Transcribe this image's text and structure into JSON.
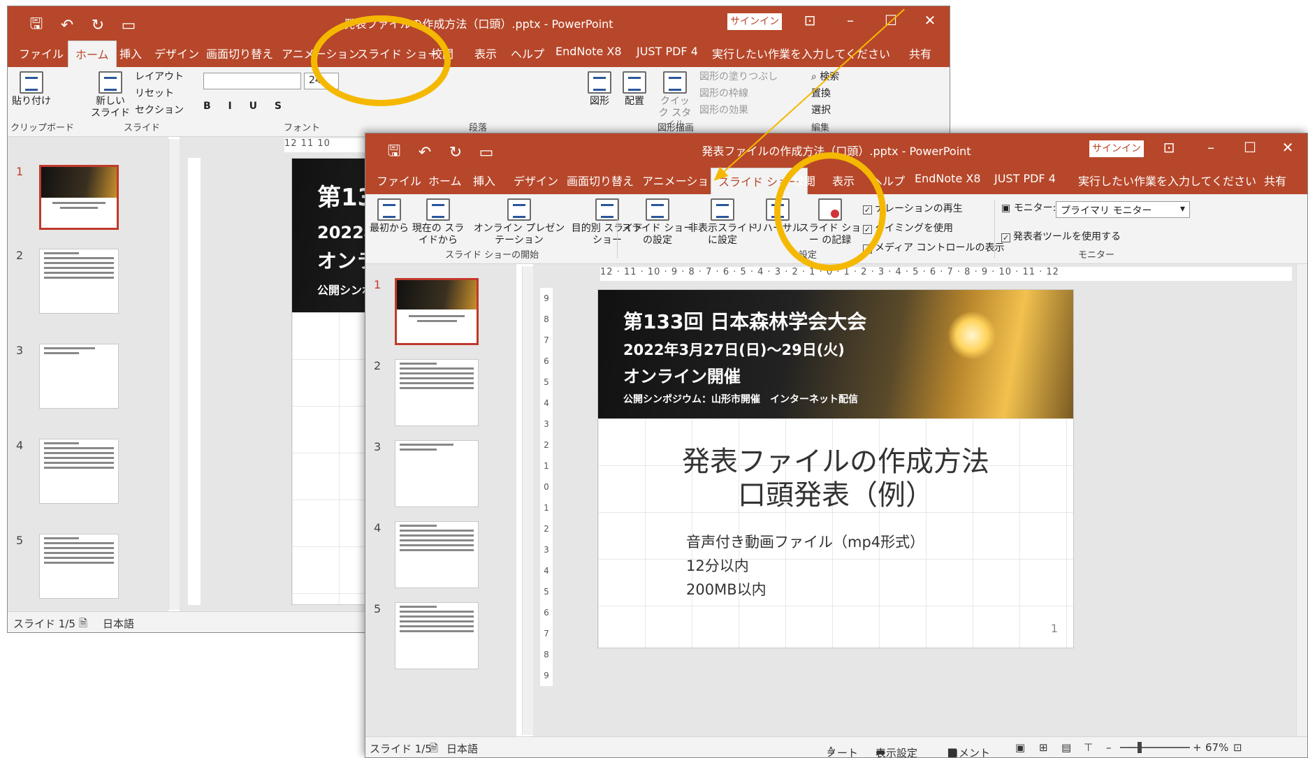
{
  "window_back": {
    "title": "発表ファイルの作成方法（口頭）.pptx - PowerPoint",
    "signin": "サインイン",
    "tabs": [
      "ファイル",
      "ホーム",
      "挿入",
      "デザイン",
      "画面切り替え",
      "アニメーション",
      "スライド ショー",
      "校閲",
      "表示",
      "ヘルプ",
      "EndNote X8",
      "JUST PDF 4",
      "実行したい作業を入力してください",
      "共有"
    ],
    "selected_tab": "ホーム",
    "ribbon": {
      "paste": "貼り付け",
      "new_slide": "新しい\nスライド",
      "layout": "レイアウト",
      "reset": "リセット",
      "section": "セクション",
      "font_size": "24",
      "shape": "図形",
      "arrange": "配置",
      "quick_style": "クイック\nスタイル",
      "shape_fill": "図形の塗りつぶし",
      "shape_outline": "図形の枠線",
      "shape_effects": "図形の効果",
      "find": "検索",
      "replace": "置換",
      "select": "選択",
      "groups": [
        "クリップボード",
        "スライド",
        "フォント",
        "段落",
        "図形描画",
        "編集"
      ]
    },
    "ruler_h": "12 11 10",
    "slide_text": {
      "b1": "第13",
      "b2": "2022年",
      "b3": "オンラ",
      "b4": "公開シンポ"
    },
    "status": {
      "slide": "スライド 1/5",
      "lang": "日本語"
    }
  },
  "window_front": {
    "title": "発表ファイルの作成方法（口頭）.pptx - PowerPoint",
    "signin": "サインイン",
    "tabs": [
      "ファイル",
      "ホーム",
      "挿入",
      "デザイン",
      "画面切り替え",
      "アニメーション",
      "スライド ショー",
      "校閲",
      "表示",
      "ヘルプ",
      "EndNote X8",
      "JUST PDF 4",
      "実行したい作業を入力してください",
      "共有"
    ],
    "selected_tab": "スライド ショー",
    "ribbon": {
      "from_start": "最初から",
      "from_current": "現在の\nスライドから",
      "online": "オンライン\nプレゼンテーション",
      "custom": "目的別\nスライド ショー",
      "setup": "スライド ショー\nの設定",
      "hide": "非表示スライド\nに設定",
      "rehearse": "リハーサル",
      "record": "スライド ショー\nの記録",
      "play_narration": "ナレーションの再生",
      "use_timings": "タイミングを使用",
      "show_media": "メディア コントロールの表示",
      "monitor_label": "モニター:",
      "monitor_value": "プライマリ モニター",
      "presenter_view": "発表者ツールを使用する",
      "group_start": "スライド ショーの開始",
      "group_setup": "設定",
      "group_monitor": "モニター"
    },
    "ruler_h": "12 · 11 · 10 · 9 · 8 · 7 · 6 · 5 · 4 · 3 · 2 · 1 · 0 · 1 · 2 · 3 · 4 · 5 · 6 · 7 · 8 · 9 · 10 · 11 · 12",
    "ruler_v": [
      "9",
      "8",
      "7",
      "6",
      "5",
      "4",
      "3",
      "2",
      "1",
      "0",
      "1",
      "2",
      "3",
      "4",
      "5",
      "6",
      "7",
      "8",
      "9"
    ],
    "slide": {
      "banner_title": "第133回 日本森林学会大会",
      "banner_date": "2022年3月27日(日)～29日(火)",
      "banner_mode": "オンライン開催",
      "banner_sub": "公開シンポジウム：山形市開催　インターネット配信",
      "title_line1": "発表ファイルの作成方法",
      "title_line2": "口頭発表（例）",
      "body": [
        "音声付き動画ファイル（mp4形式）",
        "12分以内",
        "200MB以内"
      ],
      "page_number": "1"
    },
    "status": {
      "slide": "スライド 1/5",
      "lang": "日本語",
      "notes": "ノート",
      "display": "表示設定",
      "comments": "コメント",
      "zoom": "67%"
    }
  },
  "thumbnails": [
    {
      "num": "1",
      "title": "発表ファイルの作成方法\n口頭発表（例）",
      "selected": true
    },
    {
      "num": "2",
      "heading": "おおまかな手順",
      "selected": false
    },
    {
      "num": "3",
      "heading": "2. スライドショーの記録",
      "selected": false
    },
    {
      "num": "4",
      "heading": "おおまかな手順",
      "selected": false
    },
    {
      "num": "5",
      "heading": "おおまかな手順",
      "selected": false
    }
  ],
  "colors": {
    "accent": "#b7472a",
    "highlight": "#f5b800",
    "selection": "#c0392b"
  }
}
